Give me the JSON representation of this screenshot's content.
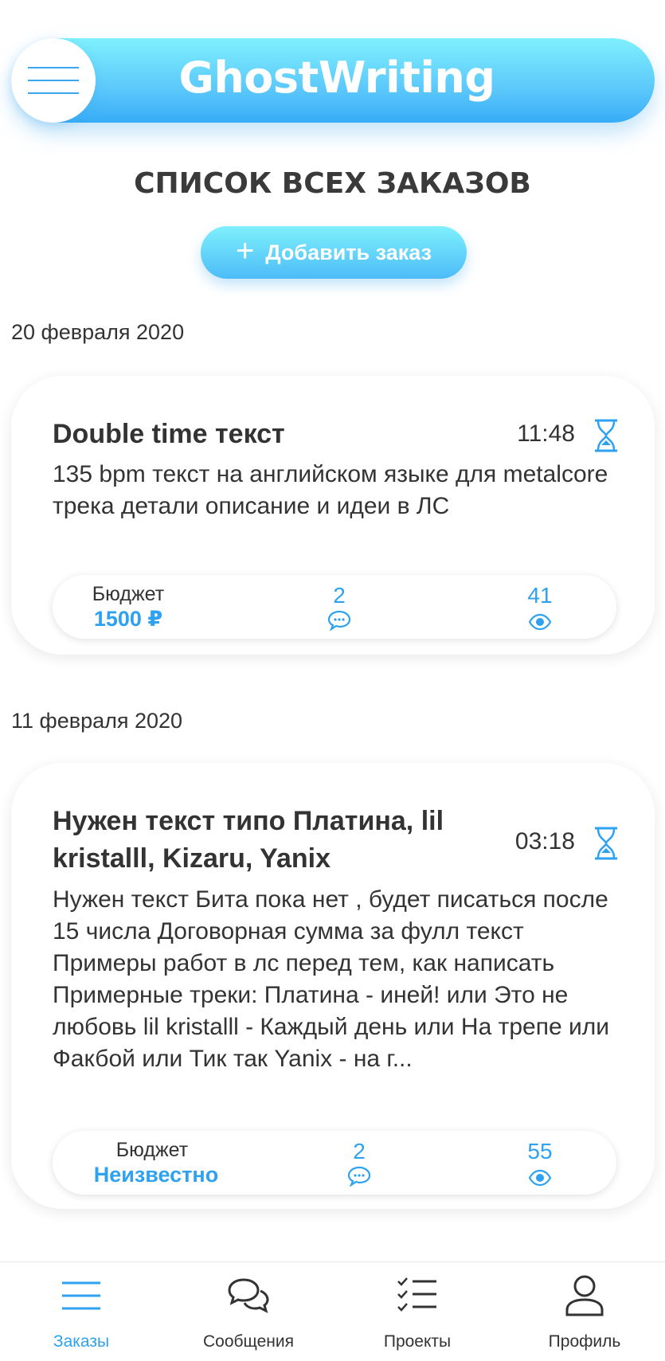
{
  "app": {
    "title": "GhostWriting",
    "accent_color": "#2ea2f0"
  },
  "page": {
    "title": "СПИСОК ВСЕХ ЗАКАЗОВ",
    "add_button_icon": "plus-icon",
    "add_button_label": "Добавить заказ"
  },
  "orders": [
    {
      "date": "20 февраля 2020",
      "title": "Double time текст",
      "time": "11:48",
      "time_icon": "hourglass-icon",
      "description": "135 bpm текст на английском языке для metalcore трека детали описание и идеи в ЛС",
      "budget_label": "Бюджет",
      "budget_value": "1500 ₽",
      "comments": "2",
      "comments_icon": "comment-icon",
      "views": "41",
      "views_icon": "eye-icon"
    },
    {
      "date": "11 февраля 2020",
      "title": "Нужен текст типо Платина, lil kristalll, Kizaru, Yanix",
      "time": "03:18",
      "time_icon": "hourglass-icon",
      "description": "Нужен текст Бита пока нет , будет писаться после 15 числа Договорная сумма за фулл текст Примеры работ в лс перед тем, как написать Примерные треки: Платина - иней! или Это не любовь lil kristalll - Каждый день или На трепе или Факбой или Тик так Yanix - на г...",
      "budget_label": "Бюджет",
      "budget_value": "Неизвестно",
      "comments": "2",
      "comments_icon": "comment-icon",
      "views": "55",
      "views_icon": "eye-icon"
    }
  ],
  "bottom_nav": [
    {
      "label": "Заказы",
      "icon": "menu-lines-icon",
      "active": true
    },
    {
      "label": "Сообщения",
      "icon": "chat-bubbles-icon",
      "active": false
    },
    {
      "label": "Проекты",
      "icon": "checklist-icon",
      "active": false
    },
    {
      "label": "Профиль",
      "icon": "user-icon",
      "active": false
    }
  ]
}
